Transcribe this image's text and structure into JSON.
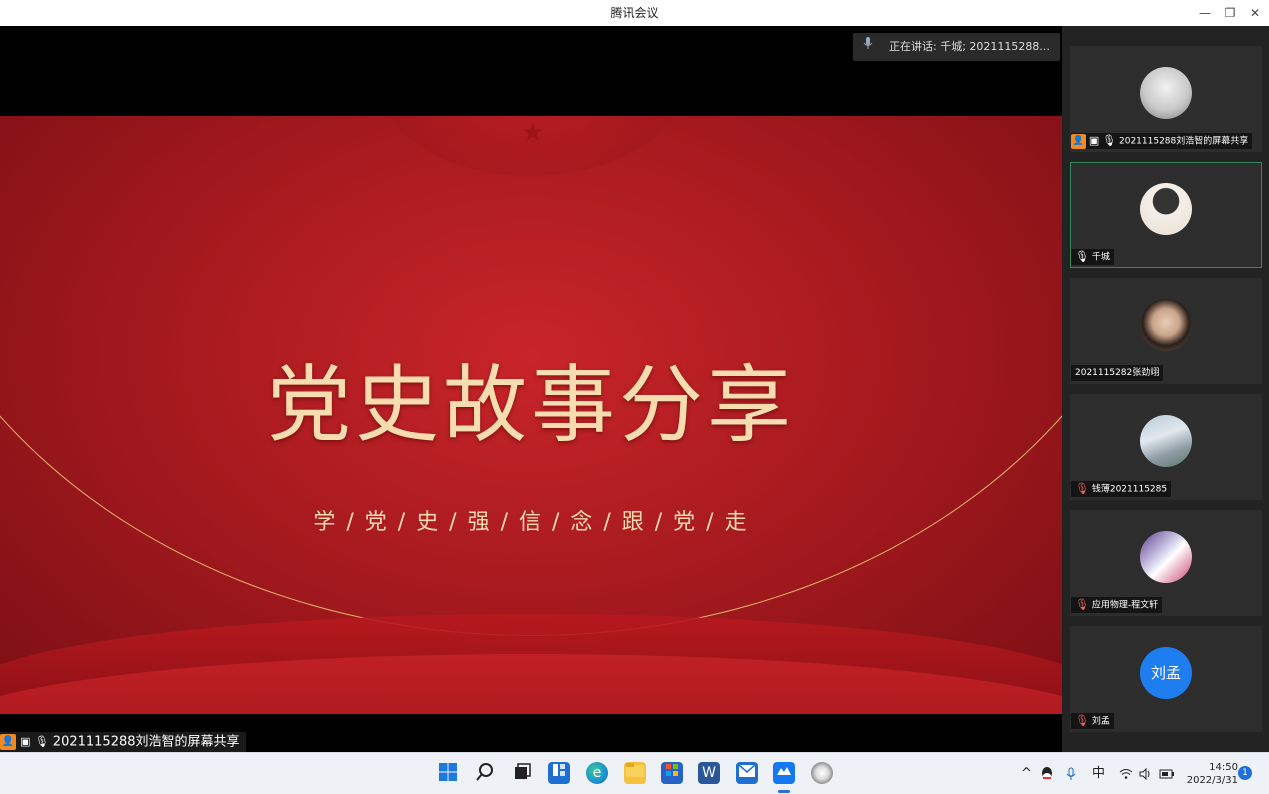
{
  "window": {
    "title": "腾讯会议",
    "minimize_glyph": "—",
    "restore_glyph": "❐",
    "close_glyph": "✕"
  },
  "speaking_banner": {
    "text": "正在讲话: 千城; 2021115288..."
  },
  "slide": {
    "title": "党史故事分享",
    "subtitle": "学 / 党 / 史 / 强 / 信 / 念 / 跟 / 党 / 走"
  },
  "share_label": {
    "text": "2021115288刘浩智的屏幕共享"
  },
  "participants": [
    {
      "name": "2021115288刘浩智的屏幕共享",
      "avatar": "anime-white-hair"
    },
    {
      "name": "千城",
      "avatar": "anime-boy"
    },
    {
      "name": "2021115282张劲翊",
      "avatar": "girl-photo"
    },
    {
      "name": "钱薄2021115285",
      "avatar": "landscape"
    },
    {
      "name": "应用物理-程文轩",
      "avatar": "anime-hat"
    },
    {
      "name": "刘孟",
      "avatar_text": "刘孟"
    }
  ],
  "taskbar": {
    "tray_ime": "中",
    "clock_time": "14:50",
    "clock_date": "2022/3/31",
    "notifications": "1"
  },
  "colors": {
    "accent_orange": "#f08a24",
    "active_border": "#2e8b57",
    "avatar_blue": "#1e7ef0",
    "slide_red": "#b81d22",
    "gold": "#f6dcae"
  }
}
